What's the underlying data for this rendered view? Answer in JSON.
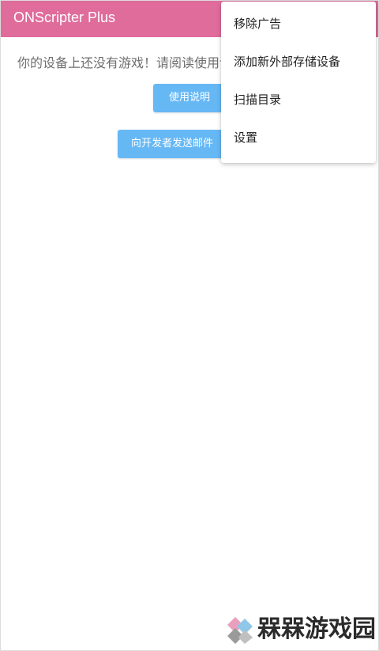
{
  "app": {
    "title": "ONScripter Plus",
    "accent_color": "#e06c9c"
  },
  "main": {
    "empty_message": "你的设备上还没有游戏！请阅读使用说明",
    "instructions_button": "使用说明",
    "email_button": "向开发者发送邮件"
  },
  "menu": {
    "items": [
      {
        "label": "移除广告"
      },
      {
        "label": "添加新外部存储设备"
      },
      {
        "label": "扫描目录"
      },
      {
        "label": "设置"
      }
    ]
  },
  "watermark": {
    "text": "槑槑游戏园",
    "icon": "diamond-logo-icon"
  }
}
